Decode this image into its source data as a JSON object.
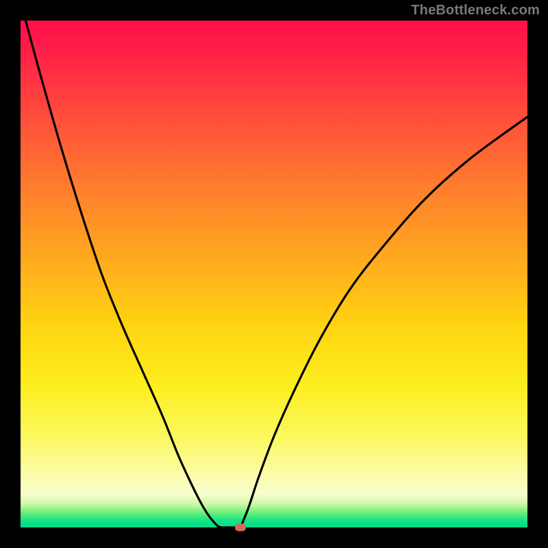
{
  "watermark": "TheBottleneck.com",
  "chart_data": {
    "type": "line",
    "title": "",
    "xlabel": "",
    "ylabel": "",
    "xlim": [
      0,
      100
    ],
    "ylim": [
      0,
      100
    ],
    "grid": false,
    "legend": false,
    "gradient_colors": {
      "top": "#ff0f4a",
      "mid_upper": "#ff7a2e",
      "mid": "#ffd311",
      "mid_lower": "#fbf85e",
      "bottom": "#06dd8a"
    },
    "series": [
      {
        "name": "bottleneck-curve-left",
        "x": [
          1,
          4,
          8,
          12,
          16,
          20,
          24,
          28,
          31,
          33.5,
          35.5,
          37,
          38.2,
          39,
          39.7
        ],
        "y": [
          100,
          89,
          75,
          62,
          50,
          40,
          31,
          22,
          14.5,
          9,
          5,
          2.5,
          1,
          0.2,
          0
        ]
      },
      {
        "name": "bottleneck-curve-flat",
        "x": [
          39.7,
          41.5,
          43.4
        ],
        "y": [
          0,
          0,
          0
        ]
      },
      {
        "name": "bottleneck-curve-right",
        "x": [
          43.4,
          45,
          47,
          50,
          54,
          59,
          65,
          72,
          80,
          89,
          100
        ],
        "y": [
          0,
          4,
          10,
          18,
          27,
          37,
          47,
          56,
          65,
          73,
          81
        ]
      }
    ],
    "marker": {
      "x": 43.4,
      "y": 0,
      "color": "#d46a5a"
    },
    "note": "Values are read from the plot in percent of the axis range; axes have no visible tick labels."
  }
}
